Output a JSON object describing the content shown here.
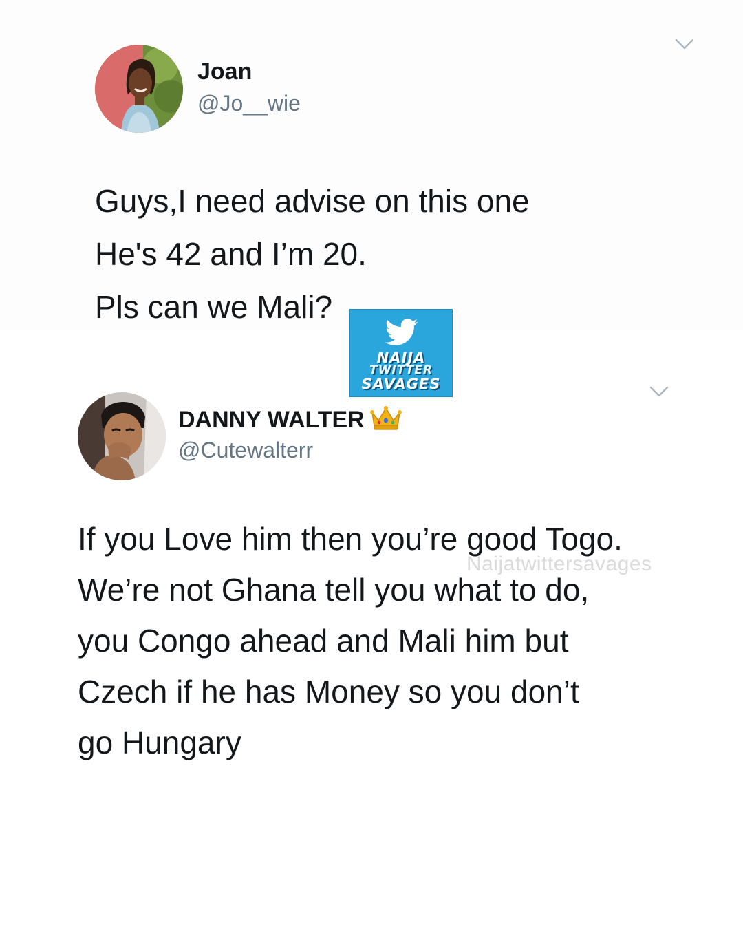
{
  "tweets": [
    {
      "author": {
        "display_name": "Joan",
        "handle": "@Jo__wie"
      },
      "icons": {
        "menu": "chevron-down-icon",
        "avatar": "profile-photo"
      },
      "text_lines": [
        "Guys,I need advise on this one",
        "He's 42 and I’m 20.",
        "Pls can we Mali?"
      ]
    },
    {
      "author": {
        "display_name": "DANNY WALTER",
        "handle": "@Cutewalterr"
      },
      "icons": {
        "menu": "chevron-down-icon",
        "badge": "crown-emoji",
        "avatar": "profile-photo"
      },
      "text_lines": [
        "If you Love him then you’re good Togo.",
        "We’re not Ghana tell you what to do,",
        "you Congo ahead and Mali him but",
        "Czech if he has Money so you don’t",
        "go Hungary"
      ]
    }
  ],
  "logo": {
    "icon": "twitter-bird-icon",
    "lines": [
      "NAIJA",
      "TWITTER",
      "SAVAGES"
    ],
    "background_color": "#2aa6dc"
  },
  "watermark": {
    "text": "Naijatwittersavages"
  },
  "colors": {
    "text": "#14171a",
    "handle": "#657786",
    "chevron": "#aab8c2"
  }
}
